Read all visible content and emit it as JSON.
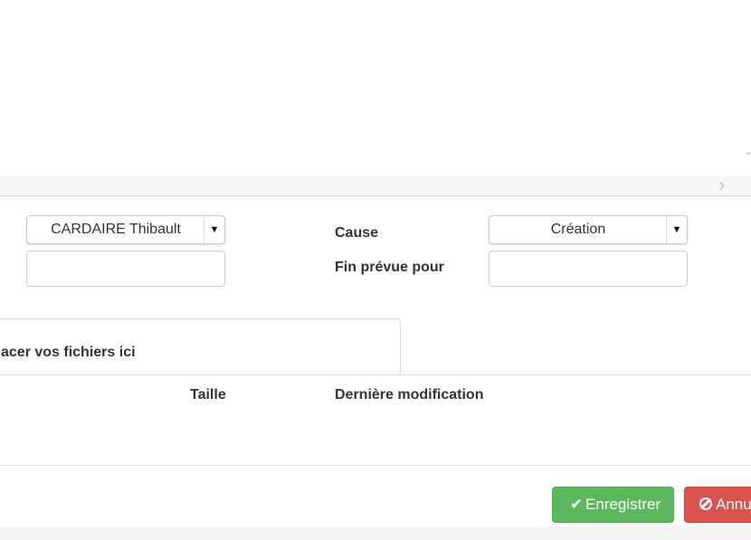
{
  "form": {
    "assignee": {
      "selected": "CARDAIRE Thibault"
    },
    "assignee_text": {
      "value": ""
    },
    "cause": {
      "label": "Cause",
      "selected": "Création"
    },
    "end_date": {
      "label": "Fin prévue pour",
      "value": ""
    }
  },
  "dropzone": {
    "text": "acer vos fichiers ici"
  },
  "file_table": {
    "columns": [
      "Taille",
      "Dernière modification"
    ]
  },
  "actions": {
    "save_label": "Enregistrer",
    "cancel_label": "Annu"
  },
  "icons": {
    "select_arrow": "caret-down-icon",
    "save": "check-icon",
    "cancel": "ban-icon",
    "scroll_right": "chevron-right-icon",
    "scroll_down": "chevron-down-icon"
  },
  "colors": {
    "save": "#5cb85c",
    "cancel": "#d9534f",
    "border": "#dddddd"
  }
}
